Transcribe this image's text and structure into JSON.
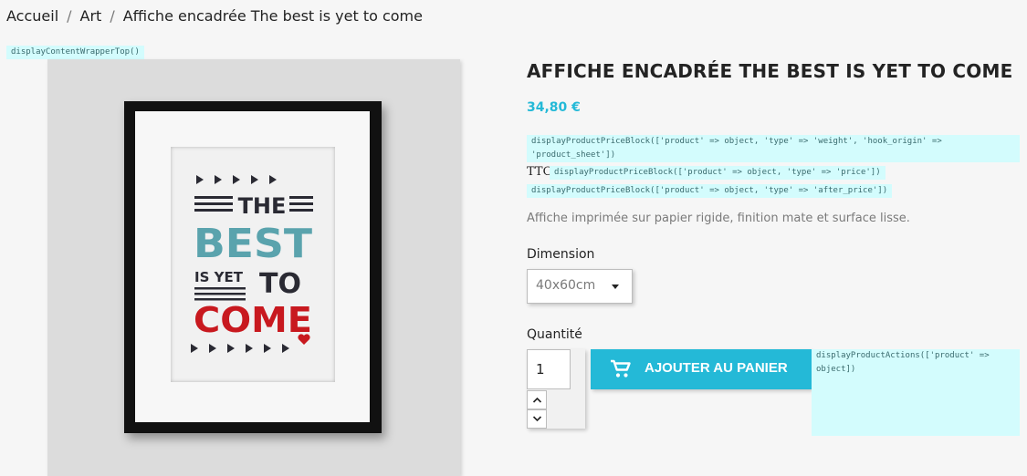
{
  "breadcrumb": {
    "items": [
      "Accueil",
      "Art",
      "Affiche encadrée The best is yet to come"
    ],
    "separator": "/"
  },
  "hooks": {
    "content_wrapper_top": "displayContentWrapperTop()",
    "price_weight": "displayProductPriceBlock(['product' => object, 'type' => 'weight', 'hook_origin' => 'product_sheet'])",
    "price_price": "displayProductPriceBlock(['product' => object, 'type' => 'price'])",
    "price_after": "displayProductPriceBlock(['product' => object, 'type' => 'after_price'])",
    "product_actions": "displayProductActions(['product' => object])"
  },
  "product": {
    "title": "AFFICHE ENCADRÉE THE BEST IS YET TO COME",
    "price": "34,80 €",
    "tax_label": "TTC",
    "description": "Affiche imprimée sur papier rigide, finition mate et surface lisse.",
    "poster_text": {
      "line1": "THE",
      "line2": "BEST",
      "line3a": "IS YET",
      "line3b": "TO",
      "line4": "COME"
    }
  },
  "variant": {
    "label": "Dimension",
    "selected": "40x60cm"
  },
  "quantity": {
    "label": "Quantité",
    "value": "1"
  },
  "cart_button": {
    "label": "AJOUTER AU PANIER"
  },
  "colors": {
    "accent": "#24b9d7",
    "hook_bg": "#d3fcfd",
    "poster_teal": "#5aa3ad",
    "poster_red": "#c8191f",
    "poster_dark": "#2a2a33"
  },
  "icons": {
    "cart": "shopping-cart-icon",
    "caret": "chevron-down-icon",
    "qty_up": "chevron-up-icon",
    "qty_down": "chevron-down-icon"
  }
}
